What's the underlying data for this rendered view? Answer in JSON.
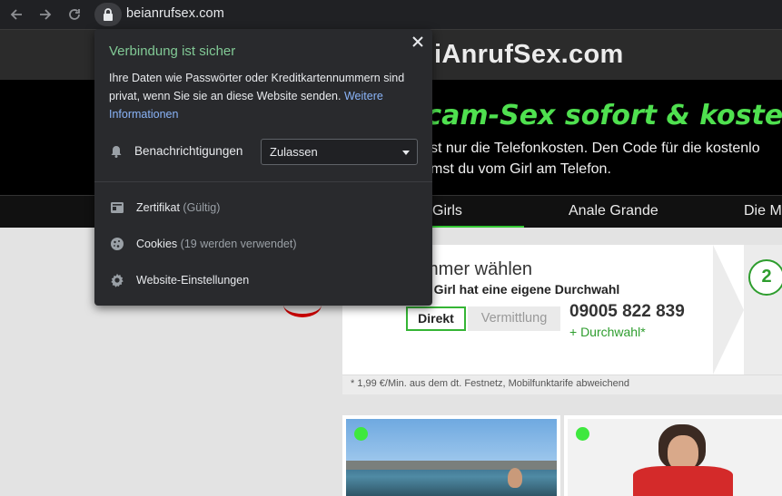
{
  "browser": {
    "url": "beianrufsex.com",
    "back_icon": "arrow-left-icon",
    "forward_icon": "arrow-right-icon",
    "reload_icon": "reload-icon",
    "lock_icon": "lock-icon"
  },
  "site": {
    "logo": "iAnrufSex.com",
    "hero_title": "ecam-Sex sofort & koste",
    "hero_line1": "st nur die Telefonkosten. Den Code für die kostenlo",
    "hero_line2": "mst du vom Girl am Telefon.",
    "nav": [
      "Girls",
      "Anale Grande",
      "Die M"
    ],
    "accent_color": "#4fe04f"
  },
  "callbox": {
    "title": "mmer wählen",
    "subtitle": "s Girl hat eine eigene Durchwahl",
    "tab_direct": "Direkt",
    "tab_switch": "Vermittlung",
    "phone": "09005 822 839",
    "extension": "+ Durchwahl*",
    "step": "2",
    "footnote": "* 1,99 €/Min. aus dem dt. Festnetz, Mobilfunktarife abweichend"
  },
  "popup": {
    "title": "Verbindung ist sicher",
    "description": "Ihre Daten wie Passwörter oder Kreditkartennummern sind privat, wenn Sie sie an diese Website senden.",
    "link": "Weitere Informationen",
    "notifications_label": "Benachrichtigungen",
    "notifications_value": "Zulassen",
    "certificate_label": "Zertifikat",
    "certificate_status": "(Gültig)",
    "cookies_label": "Cookies",
    "cookies_status": "(19 werden verwendet)",
    "site_settings_label": "Website-Einstellungen",
    "close_icon": "close-icon",
    "title_color": "#81c995",
    "link_color": "#8ab4f8"
  }
}
